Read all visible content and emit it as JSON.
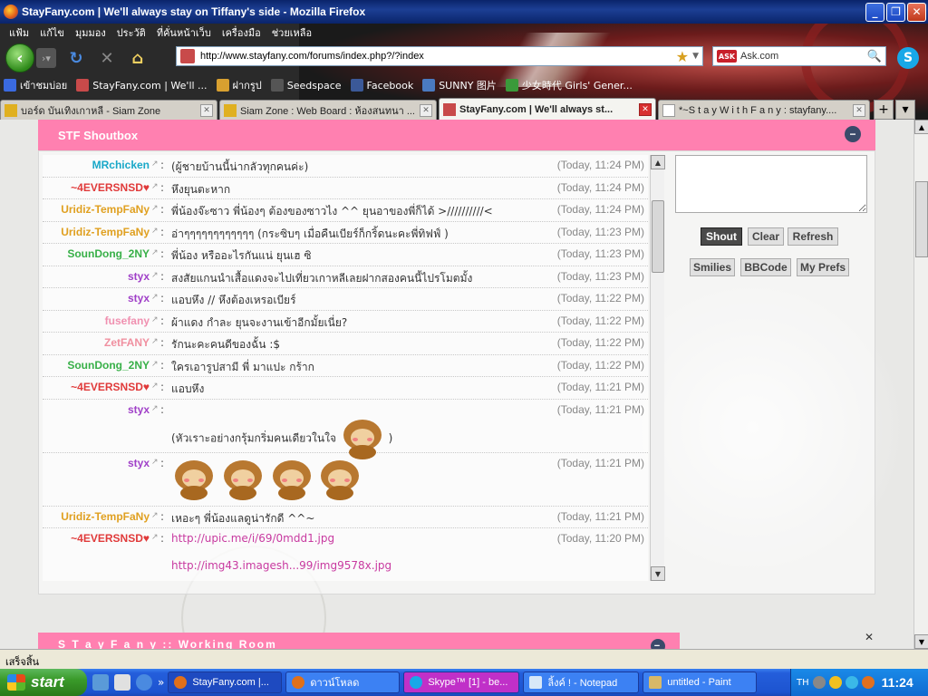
{
  "window": {
    "title": "StayFany.com | We'll always stay on Tiffany's side - Mozilla Firefox"
  },
  "menubar": [
    "แฟ้ม",
    "แก้ไข",
    "มุมมอง",
    "ประวัติ",
    "ที่คั่นหน้าเว็บ",
    "เครื่องมือ",
    "ช่วยเหลือ"
  ],
  "url": "http://www.stayfany.com/forums/index.php?/?index",
  "search": "Ask.com",
  "bookmarks": [
    "เข้าชมบ่อย",
    "StayFany.com | We'll ...",
    "ฝากรูป",
    "Seedspace",
    "Facebook",
    "SUNNY 图片",
    "少女時代 Girls' Gener..."
  ],
  "tabs": [
    {
      "label": "บอร์ด บันเทิงเกาหลี - Siam Zone",
      "active": false
    },
    {
      "label": "Siam Zone : Web Board : ห้องสนทนา ...",
      "active": false
    },
    {
      "label": "StayFany.com | We'll always st...",
      "active": true
    },
    {
      "label": "*~S t a y W i t h F a n y : stayfany....",
      "active": false
    }
  ],
  "shoutbox": {
    "title": "STF Shoutbox",
    "buttons": {
      "shout": "Shout",
      "clear": "Clear",
      "refresh": "Refresh",
      "smilies": "Smilies",
      "bbcode": "BBCode",
      "prefs": "My Prefs"
    },
    "messages": [
      {
        "user": "MRchicken",
        "color": "#18a8c8",
        "text": "(ผู้ชายบ้านนี้น่ากลัวทุกคนค่ะ)",
        "time": "(Today, 11:24 PM)"
      },
      {
        "user": "~4EVERSNSD♥",
        "color": "#e03a3a",
        "text": "หึงยุนตะหาก",
        "time": "(Today, 11:24 PM)"
      },
      {
        "user": "Uridiz-TempFaNy",
        "color": "#e0a020",
        "text": "พี่น้องจ๊ะซาว พี่น้องๆ ต้องของซาวไง ^^ ยุนอาของพี่ก็ได้ >//////////<",
        "time": "(Today, 11:24 PM)"
      },
      {
        "user": "Uridiz-TempFaNy",
        "color": "#e0a020",
        "text": "อ่าๆๆๆๆๆๆๆๆๆๆๆๆ (กระซิบๆ เมื่อคืนเบียร์ก็กริ้ดนะคะพี่ทิฟฟ์ )",
        "time": "(Today, 11:23 PM)"
      },
      {
        "user": "SounDong_2NY",
        "color": "#38b048",
        "text": "พี่น้อง หรืออะไรกันแน่ ยุนเฮ ซิ",
        "time": "(Today, 11:23 PM)"
      },
      {
        "user": "styx",
        "color": "#a040c8",
        "text": "สงสัยแกนนำเสื้อแดงจะไปเที่ยวเกาหลีเลยฝากสองคนนี้ไปรโมตมั้ง",
        "time": "(Today, 11:23 PM)"
      },
      {
        "user": "styx",
        "color": "#a040c8",
        "text": "แอบหึง // หึงต้องเหรอเบียร์",
        "time": "(Today, 11:22 PM)"
      },
      {
        "user": "fusefany",
        "color": "#f090b0",
        "text": "ผ้าแดง กำละ ยุนจะงานเข้าอีกมั้ยเนี่ย?",
        "time": "(Today, 11:22 PM)"
      },
      {
        "user": "ZetFANY",
        "color": "#f090a0",
        "text": "รักนะคะคนดีของฉั้น :$",
        "time": "(Today, 11:22 PM)"
      },
      {
        "user": "SounDong_2NY",
        "color": "#38b048",
        "text": "ใครเอารูปสามี พี่ มาแปะ กร้าก",
        "time": "(Today, 11:22 PM)"
      },
      {
        "user": "~4EVERSNSD♥",
        "color": "#e03a3a",
        "text": "แอบหึง",
        "time": "(Today, 11:21 PM)"
      },
      {
        "user": "styx",
        "color": "#a040c8",
        "text": "(หัวเราะอย่างกรุ้มกริ่มคนเดียวในใจ",
        "text_end": ")",
        "time": "(Today, 11:21 PM)"
      },
      {
        "user": "styx",
        "color": "#a040c8",
        "text": "",
        "time": "(Today, 11:21 PM)"
      },
      {
        "user": "Uridiz-TempFaNy",
        "color": "#e0a020",
        "text": "เหอะๆ พี่น้องแลดูน่ารักดี ^^~",
        "time": "(Today, 11:21 PM)"
      },
      {
        "user": "~4EVERSNSD♥",
        "color": "#e03a3a",
        "text": "http://upic.me/i/69/0mdd1.jpg",
        "time": "(Today, 11:20 PM)",
        "link2": "http://img43.imagesh...99/img9578x.jpg"
      }
    ]
  },
  "working_room": "S T a y F a n y :: Working Room",
  "status": "เสร็จสิ้น",
  "taskbar": {
    "start": "start",
    "tasks": [
      "StayFany.com |...",
      "ดาวน์โหลด",
      "Skype™ [1] - be...",
      "ลิ้งค์ ! - Notepad",
      "untitled - Paint"
    ],
    "lang": "TH",
    "clock": "11:24"
  }
}
